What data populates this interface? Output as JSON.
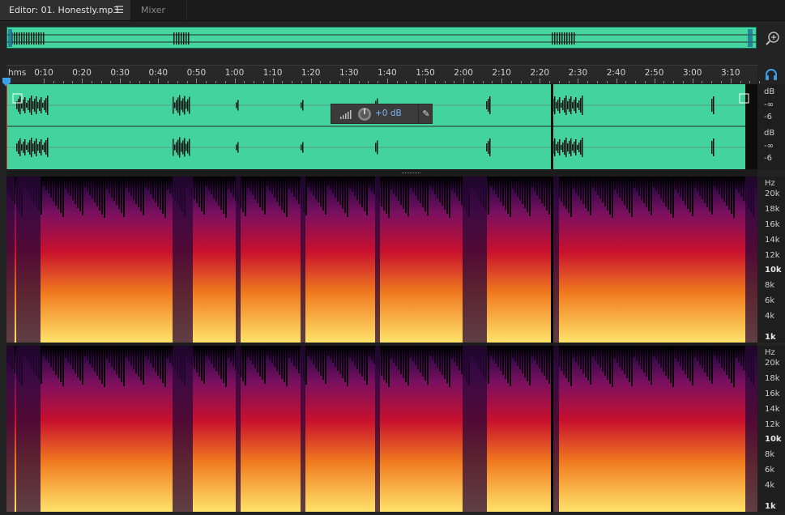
{
  "tabs": {
    "editor_label": "Editor: 01. Honestly.mp3",
    "editor_menu_icon": "hamburger-menu-icon",
    "mixer_label": "Mixer"
  },
  "ruler": {
    "unit": "hms",
    "labels": [
      "0:10",
      "0:20",
      "0:30",
      "0:40",
      "0:50",
      "1:00",
      "1:10",
      "1:20",
      "1:30",
      "1:40",
      "1:50",
      "2:00",
      "2:10",
      "2:20",
      "2:30",
      "2:40",
      "2:50",
      "3:00",
      "3:10"
    ]
  },
  "amplitude_scale": {
    "channel1": [
      "dB",
      "-∞",
      "-6"
    ],
    "channel2": [
      "dB",
      "-∞",
      "-6"
    ]
  },
  "hud": {
    "gain": "+0 dB",
    "pin_icon": "pin-icon",
    "knob_icon": "volume-knob-icon",
    "meter_icon": "level-meter-icon"
  },
  "frequency_scale": {
    "unit": "Hz",
    "labels": [
      "20k",
      "18k",
      "16k",
      "14k",
      "12k",
      "10k",
      "8k",
      "6k",
      "4k",
      "1k"
    ],
    "bold": [
      "10k",
      "1k"
    ]
  },
  "colors": {
    "waveform": "#42d39e",
    "background": "#232323",
    "spectrum_low": "#000000",
    "spectrum_mid": "#c8102e",
    "spectrum_high": "#ffe36b"
  }
}
